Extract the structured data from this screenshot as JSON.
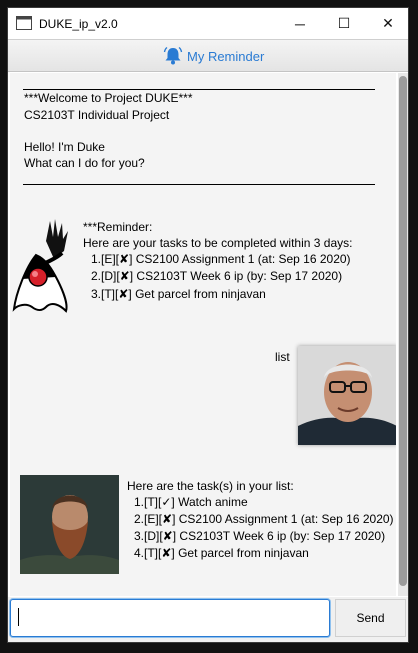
{
  "window": {
    "title": "DUKE_ip_v2.0",
    "minimize_glyph": "─",
    "maximize_glyph": "☐",
    "close_glyph": "✕"
  },
  "reminder_button": {
    "label": "My Reminder",
    "icon": "bell-icon",
    "color": "#2a7bd3"
  },
  "dialog": {
    "welcome": {
      "line1": "***Welcome to Project DUKE***",
      "line2": "CS2103T Individual Project",
      "line3": "Hello! I'm Duke",
      "line4": "What can I do for you?"
    },
    "reminder": {
      "header": "***Reminder:",
      "intro": "Here are your tasks to be completed within 3 days:",
      "items": [
        "1.[E][✘] CS2100 Assignment 1 (at: Sep 16 2020)",
        "2.[D][✘] CS2103T Week 6 ip (by: Sep 17 2020)",
        "3.[T][✘] Get parcel from ninjavan"
      ]
    },
    "user_message": "list",
    "list_response": {
      "intro": "Here are the task(s) in your list:",
      "items": [
        "1.[T][✓] Watch anime",
        "2.[E][✘] CS2100 Assignment 1 (at: Sep 16 2020)",
        "3.[D][✘] CS2103T Week 6 ip (by: Sep 17 2020)",
        "4.[T][✘] Get parcel from ninjavan"
      ]
    }
  },
  "input": {
    "value": "",
    "send_label": "Send",
    "accent": "#2a7bd3"
  }
}
